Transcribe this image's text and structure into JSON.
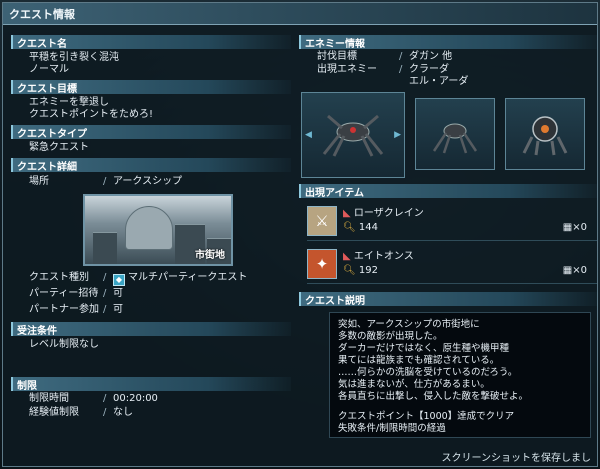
{
  "window": {
    "title": "クエスト情報"
  },
  "left": {
    "quest_name": {
      "header": "クエスト名",
      "name": "平穏を引き裂く混沌",
      "difficulty": "ノーマル"
    },
    "objective": {
      "header": "クエスト目標",
      "lines": [
        "エネミーを撃退し",
        "クエストポイントをためろ!"
      ]
    },
    "type": {
      "header": "クエストタイプ",
      "value": "緊急クエスト"
    },
    "details": {
      "header": "クエスト詳細",
      "location_label": "場所",
      "location_value": "アークスシップ",
      "map_caption": "市街地",
      "category_label": "クエスト種別",
      "category_value": "マルチパーティークエスト",
      "party_label": "パーティー招待",
      "party_value": "可",
      "partner_label": "パートナー参加",
      "partner_value": "可"
    },
    "conditions": {
      "header": "受注条件",
      "value": "レベル制限なし"
    },
    "limits": {
      "header": "制限",
      "time_label": "制限時間",
      "time_value": "00:20:00",
      "exp_label": "経験値制限",
      "exp_value": "なし"
    }
  },
  "right": {
    "enemy": {
      "header": "エネミー情報",
      "target_label": "討伐目標",
      "target_value": "ダガン 他",
      "appear_label": "出現エネミー",
      "appear_lines": [
        "クラーダ",
        "エル・アーダ"
      ]
    },
    "items": {
      "header": "出現アイテム",
      "list": [
        {
          "name": "ローザクレイン",
          "count": "144",
          "multiplier": "×0"
        },
        {
          "name": "エイトオンス",
          "count": "192",
          "multiplier": "×0"
        }
      ]
    },
    "description": {
      "header": "クエスト説明",
      "lines": [
        "突如、アークスシップの市街地に",
        "多数の敵影が出現した。",
        "ダーカーだけではなく、原生種や機甲種",
        "果てには龍族までも確認されている。",
        "……何らかの洗脳を受けているのだろう。",
        "気は進まないが、仕方があるまい。",
        "各員直ちに出撃し、侵入した敵を撃破せよ。"
      ],
      "clear_lines": [
        "クエストポイント【1000】達成でクリア",
        "失敗条件/制限時間の経過"
      ]
    }
  },
  "footer": {
    "notice": "スクリーンショットを保存しまし"
  },
  "colors": {
    "accent": "#3f6b80",
    "frame": "#5e7a88",
    "text": "#e6eef4"
  }
}
